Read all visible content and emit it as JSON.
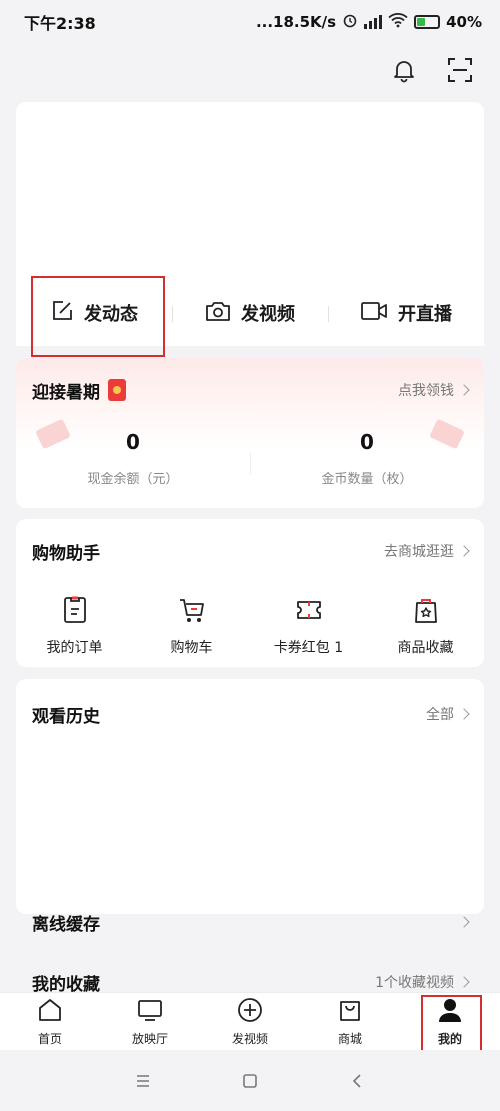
{
  "status": {
    "time": "下午2:38",
    "netspeed": "...18.5K/s",
    "battery": "40%"
  },
  "actions": [
    {
      "label": "发动态",
      "icon": "edit-icon"
    },
    {
      "label": "发视频",
      "icon": "camera-icon"
    },
    {
      "label": "开直播",
      "icon": "video-camera-icon"
    }
  ],
  "summer": {
    "title": "迎接暑期",
    "link": "点我领钱",
    "cash_value": "0",
    "cash_label": "现金余额（元）",
    "coins_value": "0",
    "coins_label": "金币数量（枚）"
  },
  "shop": {
    "title": "购物助手",
    "link": "去商城逛逛",
    "items": [
      {
        "label": "我的订单",
        "icon": "order-icon"
      },
      {
        "label": "购物车",
        "icon": "cart-icon"
      },
      {
        "label": "卡券红包 1",
        "icon": "coupon-icon"
      },
      {
        "label": "商品收藏",
        "icon": "favorite-bag-icon"
      }
    ]
  },
  "history": {
    "title": "观看历史",
    "link": "全部"
  },
  "offline": {
    "title": "离线缓存"
  },
  "collection": {
    "title": "我的收藏",
    "link": "1个收藏视频"
  },
  "tabs": [
    {
      "label": "首页",
      "icon": "home-icon"
    },
    {
      "label": "放映厅",
      "icon": "tv-icon"
    },
    {
      "label": "发视频",
      "icon": "plus-circle-icon"
    },
    {
      "label": "商城",
      "icon": "shopping-bag-icon"
    },
    {
      "label": "我的",
      "icon": "person-icon",
      "active": true
    }
  ],
  "colors": {
    "highlight": "#d32f2f",
    "accent_red": "#ec3b3b"
  }
}
